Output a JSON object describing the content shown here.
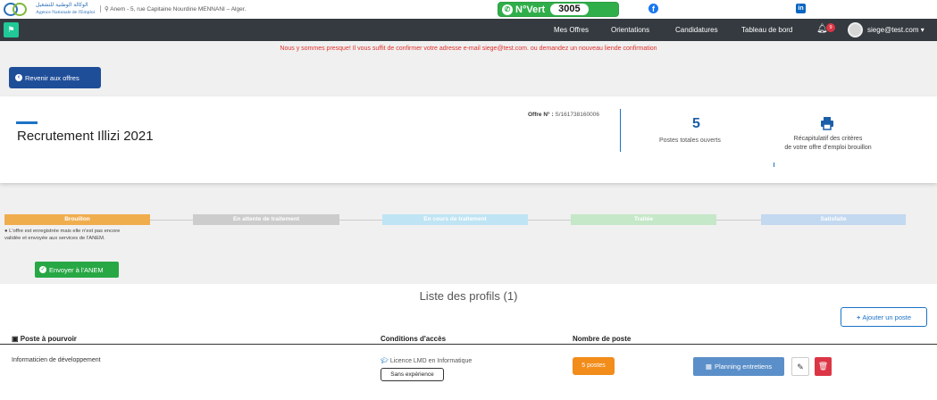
{
  "topbar": {
    "logo_arabic": "الوكالة الوطنية للتشغيل",
    "logo_french": "Agence Nationale de l'Emploi",
    "address": "Anem - 5, rue Capitaine Nourdine MENNANI – Alger.",
    "nvert_label": "N°Vert",
    "nvert_number": "3005",
    "facebook_icon": "facebook-icon",
    "linkedin_icon": "linkedin-icon"
  },
  "navbar": {
    "items": [
      "Mes Offres",
      "Orientations",
      "Candidatures",
      "Tableau de bord"
    ],
    "notif_count": "9",
    "user": "siege@test.com"
  },
  "alert": {
    "text": "Nous y sommes presque! Il vous suffit de confirmer votre adresse e-mail siege@test.com. ou demandez un nouveau",
    "link": "liende confirmation"
  },
  "back_button": "Revenir aux offres",
  "header": {
    "title": "Recrutement Illizi 2021",
    "offer_label": "Offre N° :",
    "offer_number": "S/161738160006",
    "postes_count": "5",
    "postes_label": "Postes totales ouverts",
    "recap_line1": "Récapitulatif des critères",
    "recap_line2": "de votre offre d'emploi brouillon"
  },
  "steps": [
    {
      "label": "Brouillon",
      "color": "#f0ad4e"
    },
    {
      "label": "En attente de traitement",
      "color": "#cccccc"
    },
    {
      "label": "En cours de traitement",
      "color": "#bfe4f4"
    },
    {
      "label": "Traitée",
      "color": "#c5e8c8"
    },
    {
      "label": "Satisfaite",
      "color": "#c3d9f0"
    }
  ],
  "step_note": "L'offre est enregistrée mais elle n'est pas encore validée et envoyée aux services de l'ANEM.",
  "send_button": "Envoyer à l'ANEM",
  "profiles": {
    "title": "Liste des profils (1)",
    "add_button": "Ajouter un poste",
    "columns": [
      "Poste à pourvoir",
      "Conditions d'accès",
      "Nombre de poste"
    ],
    "rows": [
      {
        "name": "Informaticien de développement",
        "condition": "Licence LMD en Informatique",
        "experience": "Sans expérience",
        "count": "5 postes",
        "planning": "Planning entretiens"
      }
    ]
  }
}
